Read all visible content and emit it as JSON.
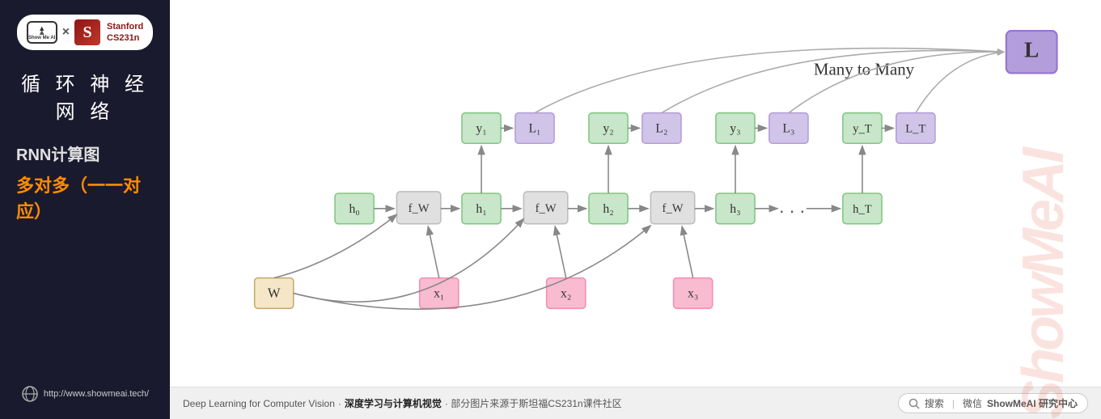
{
  "sidebar": {
    "logo_text": "Show Me AI",
    "times": "×",
    "stanford_s": "S",
    "stanford_name": "Stanford",
    "course": "CS231n",
    "title_chinese": "循 环 神 经 网 络",
    "subtitle_rnn": "RNN计算图",
    "subtitle_type": "多对多（一一对应）",
    "website": "http://www.showmeai.tech/"
  },
  "main": {
    "many_to_many_label": "Many to Many",
    "watermark_text": "ShowMeAI",
    "bottom_text_en": "Deep Learning for Computer Vision",
    "bottom_dot": "·",
    "bottom_text_cn": "深度学习与计算机视觉",
    "bottom_suffix": "· 部分图片来源于斯坦福CS231n课件社区",
    "search_label": "搜索",
    "separator": "|",
    "wechat_label": "微信",
    "showmeai_label": "ShowMeAI 研究中心"
  },
  "diagram": {
    "nodes": {
      "h0": "h₀",
      "fw1": "f_W",
      "h1": "h₁",
      "fw2": "f_W",
      "h2": "h₂",
      "fw3": "f_W",
      "h3": "h₃",
      "dots": "...",
      "hT": "hT",
      "W": "W",
      "x1": "x₁",
      "x2": "x₂",
      "x3": "x₃",
      "y1": "y₁",
      "L1": "L₁",
      "y2": "y₂",
      "L2": "L₂",
      "y3": "y₃",
      "L3": "L₃",
      "yT": "yT",
      "LT": "LT",
      "L_total": "L"
    }
  }
}
